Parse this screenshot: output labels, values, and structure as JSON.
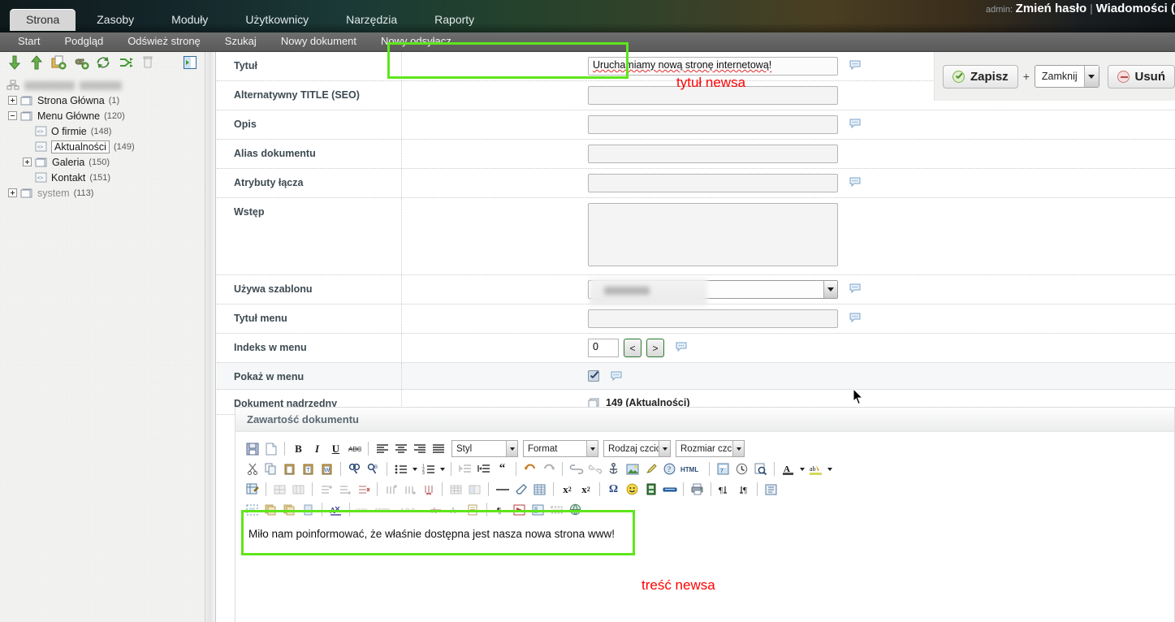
{
  "header": {
    "admin_label": "admin:",
    "change_password": "Zmień hasło",
    "separator": "|",
    "messages": "Wiadomości (",
    "tabs": [
      {
        "label": "Strona",
        "active": true
      },
      {
        "label": "Zasoby",
        "active": false
      },
      {
        "label": "Moduły",
        "active": false
      },
      {
        "label": "Użytkownicy",
        "active": false
      },
      {
        "label": "Narzędzia",
        "active": false
      },
      {
        "label": "Raporty",
        "active": false
      }
    ],
    "submenu": [
      "Start",
      "Podgląd",
      "Odśwież stronę",
      "Szukaj",
      "Nowy dokument",
      "Nowy odsyłacz"
    ]
  },
  "sidebar": {
    "toolbar_icons": [
      "move-down-icon",
      "move-up-icon",
      "new-document-icon",
      "new-link-icon",
      "refresh-icon",
      "sort-icon",
      "trash-icon"
    ],
    "collapse_icon": "collapse-panel-icon",
    "root_label": "",
    "tree": [
      {
        "label": "Strona Główna",
        "count": "(1)",
        "expander": "plus",
        "indent": 0,
        "icon": "folder-icon",
        "selected": false,
        "dim": false
      },
      {
        "label": "Menu Główne",
        "count": "(120)",
        "expander": "minus",
        "indent": 0,
        "icon": "folder-icon",
        "selected": false,
        "dim": false
      },
      {
        "label": "O firmie",
        "count": "(148)",
        "expander": "none",
        "indent": 1,
        "icon": "page-icon",
        "selected": false,
        "dim": false
      },
      {
        "label": "Aktualności",
        "count": "(149)",
        "expander": "none",
        "indent": 1,
        "icon": "page-icon",
        "selected": true,
        "dim": false
      },
      {
        "label": "Galeria",
        "count": "(150)",
        "expander": "plus",
        "indent": 1,
        "icon": "folder-icon",
        "selected": false,
        "dim": false
      },
      {
        "label": "Kontakt",
        "count": "(151)",
        "expander": "none",
        "indent": 1,
        "icon": "page-icon",
        "selected": false,
        "dim": false
      },
      {
        "label": "system",
        "count": "(113)",
        "expander": "plus",
        "indent": 0,
        "icon": "folder-icon",
        "selected": false,
        "dim": true
      }
    ]
  },
  "actions": {
    "save_label": "Zapisz",
    "plus": "+",
    "close_option": "Zamknij",
    "delete_label": "Usuń"
  },
  "form": {
    "rows": [
      {
        "label": "Tytuł",
        "value": "Uruchamiamy nową stronę internetową!",
        "type": "text"
      },
      {
        "label": "Alternatywny TITLE (SEO)",
        "value": "",
        "type": "text"
      },
      {
        "label": "Opis",
        "value": "",
        "type": "text"
      },
      {
        "label": "Alias dokumentu",
        "value": "",
        "type": "text"
      },
      {
        "label": "Atrybuty łącza",
        "value": "",
        "type": "text"
      },
      {
        "label": "Wstęp",
        "value": "",
        "type": "textarea"
      },
      {
        "label": "Używa szablonu",
        "value": "",
        "type": "select"
      },
      {
        "label": "Tytuł menu",
        "value": "",
        "type": "text"
      },
      {
        "label": "Indeks w menu",
        "value": "0",
        "type": "number"
      },
      {
        "label": "Pokaż w menu",
        "value": "",
        "type": "checkbox"
      },
      {
        "label": "Dokument nadrzędny",
        "value": "149 (Aktualności)",
        "type": "static"
      }
    ],
    "step_prev": "<",
    "step_next": ">"
  },
  "editor": {
    "panel_title": "Zawartość dokumentu",
    "dropdowns": [
      "Styl",
      "Format",
      "Rodzaj czcionki",
      "Rozmiar czcionki"
    ],
    "content": "Miło nam poinformować, że właśnie dostępna jest nasza nowa strona www!",
    "toolbar_row1": [
      "save-icon",
      "new-page-icon",
      "bold-icon",
      "italic-icon",
      "underline-icon",
      "strikethrough-icon",
      "align-left-icon",
      "align-center-icon",
      "align-right-icon",
      "align-justify-icon"
    ],
    "toolbar_row2": [
      "cut-icon",
      "copy-icon",
      "paste-icon",
      "paste-text-icon",
      "paste-word-icon",
      "find-icon",
      "replace-icon",
      "bullet-list-icon",
      "numbered-list-icon",
      "outdent-icon",
      "indent-icon",
      "blockquote-icon",
      "undo-icon",
      "redo-icon",
      "link-icon",
      "unlink-icon",
      "anchor-icon",
      "image-icon",
      "brush-icon",
      "help-icon",
      "html-source-icon",
      "template-icon",
      "clock-icon",
      "preview-icon",
      "text-color-icon",
      "background-color-icon"
    ],
    "toolbar_row3": [
      "table-properties-icon",
      "merge-cells-icon",
      "split-cells-icon",
      "insert-row-before-icon",
      "insert-row-after-icon",
      "delete-row-icon",
      "insert-column-before-icon",
      "insert-column-after-icon",
      "delete-column-icon",
      "table-icon",
      "table-cell-icon",
      "horizontal-rule-icon",
      "eraser-icon",
      "grid-icon",
      "subscript-icon",
      "superscript-icon",
      "special-character-icon",
      "smiley-icon",
      "media-icon",
      "page-break-icon",
      "print-icon",
      "text-ltr-icon",
      "text-rtl-icon",
      "show-blocks-icon"
    ],
    "toolbar_row4": [
      "select-all-icon",
      "copy-formatting-icon",
      "paste-formatting-icon",
      "remove-format-icon",
      "spellcheck-icon",
      "quote-icon",
      "abbr-icon",
      "acronym-icon",
      "strike-format-icon",
      "font-format-icon",
      "doc-props-icon",
      "paragraph-icon",
      "flash-icon",
      "iframe-icon",
      "div-icon",
      "world-icon"
    ]
  },
  "annotations": {
    "title_note": "tytuł newsa",
    "content_note": "treść newsa",
    "box_color": "#5fe61b",
    "text_color": "#ff0000"
  }
}
